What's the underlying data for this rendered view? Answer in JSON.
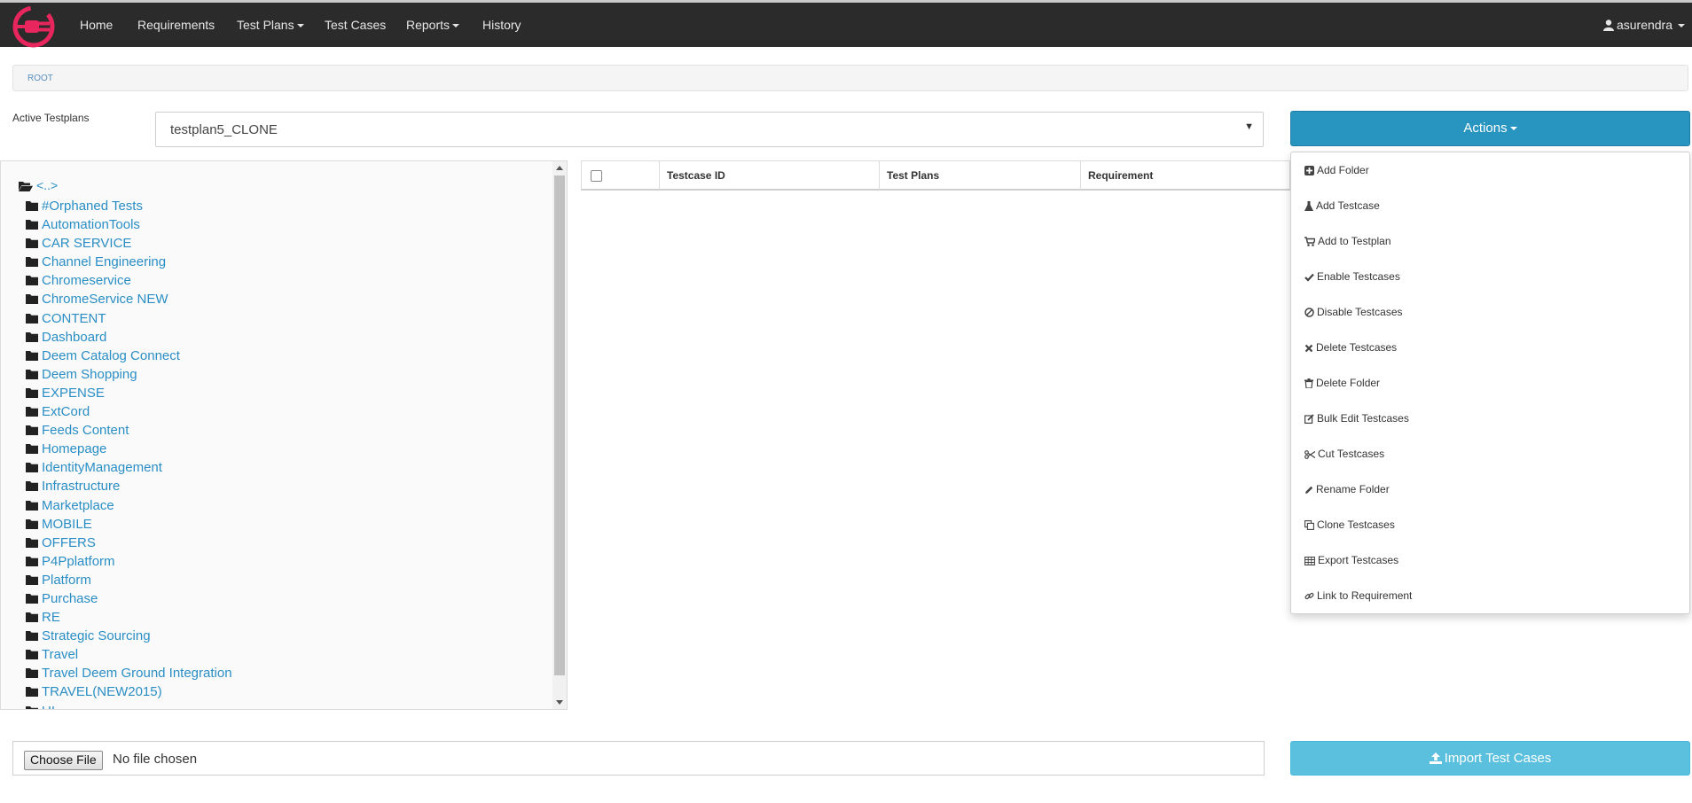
{
  "nav": {
    "items": [
      {
        "label": "Home",
        "dropdown": false
      },
      {
        "label": "Requirements",
        "dropdown": false
      },
      {
        "label": "Test Plans",
        "dropdown": true
      },
      {
        "label": "Test Cases",
        "dropdown": false
      },
      {
        "label": "Reports",
        "dropdown": true
      },
      {
        "label": "History",
        "dropdown": false
      }
    ],
    "user": "asurendra"
  },
  "breadcrumb": {
    "root": "ROOT"
  },
  "testplan": {
    "label": "Active Testplans",
    "selected": "testplan5_CLONE"
  },
  "actions": {
    "label": "Actions",
    "menu": [
      {
        "label": "Add Folder",
        "icon": "plus-square-icon"
      },
      {
        "label": "Add Testcase",
        "icon": "flask-icon"
      },
      {
        "label": "Add to Testplan",
        "icon": "cart-icon"
      },
      {
        "label": "Enable Testcases",
        "icon": "check-icon"
      },
      {
        "label": "Disable Testcases",
        "icon": "ban-icon"
      },
      {
        "label": "Delete Testcases",
        "icon": "times-icon"
      },
      {
        "label": "Delete Folder",
        "icon": "trash-icon"
      },
      {
        "label": "Bulk Edit Testcases",
        "icon": "edit-icon"
      },
      {
        "label": "Cut Testcases",
        "icon": "scissors-icon"
      },
      {
        "label": "Rename Folder",
        "icon": "pencil-icon"
      },
      {
        "label": "Clone Testcases",
        "icon": "copy-icon"
      },
      {
        "label": "Export Testcases",
        "icon": "table-icon"
      },
      {
        "label": "Link to Requirement",
        "icon": "link-icon"
      }
    ]
  },
  "tree": {
    "root": "<..>",
    "folders": [
      "#Orphaned Tests",
      "AutomationTools",
      "CAR SERVICE",
      "Channel Engineering",
      "Chromeservice",
      "ChromeService NEW",
      "CONTENT",
      "Dashboard",
      "Deem Catalog Connect",
      "Deem Shopping",
      "EXPENSE",
      "ExtCord",
      "Feeds Content",
      "Homepage",
      "IdentityManagement",
      "Infrastructure",
      "Marketplace",
      "MOBILE",
      "OFFERS",
      "P4Pplatform",
      "Platform",
      "Purchase",
      "RE",
      "Strategic Sourcing",
      "Travel",
      "Travel Deem Ground Integration",
      "TRAVEL(NEW2015)",
      "UI"
    ]
  },
  "table": {
    "columns": [
      "Testcase ID",
      "Test Plans",
      "Requirement"
    ]
  },
  "upload": {
    "choose_label": "Choose File",
    "status": "No file chosen",
    "import_label": "Import Test Cases"
  },
  "colors": {
    "navbar": "#2b2b2b",
    "logo": "#e8265e",
    "actions": "#2895c1",
    "import": "#5bc0de",
    "link": "#2a8ec5"
  }
}
